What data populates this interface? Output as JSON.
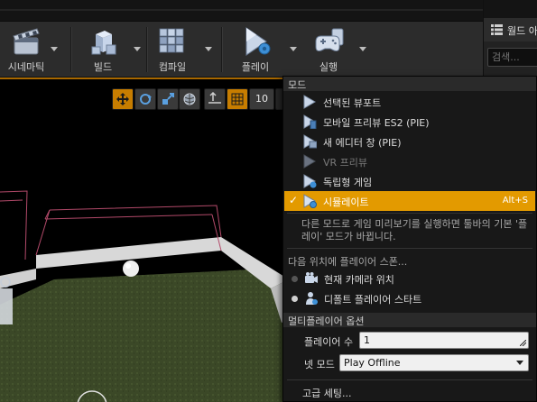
{
  "toolbar": {
    "buttons": [
      {
        "label": "시네마틱",
        "icon": "clapperboard-icon"
      },
      {
        "label": "빌드",
        "icon": "build-blocks-icon"
      },
      {
        "label": "컴파일",
        "icon": "compile-cubes-icon"
      },
      {
        "label": "플레이",
        "icon": "play-gear-icon"
      },
      {
        "label": "실행",
        "icon": "launch-gamepad-icon"
      }
    ]
  },
  "outliner": {
    "title": "월드 아",
    "search_placeholder": "검색..."
  },
  "viewport": {
    "grid_snap_value": "10"
  },
  "menu": {
    "mode_header": "모드",
    "mode_items": [
      {
        "label": "선택된 뷰포트",
        "enabled": true
      },
      {
        "label": "모바일 프리뷰 ES2 (PIE)",
        "enabled": true
      },
      {
        "label": "새 에디터 창 (PIE)",
        "enabled": true
      },
      {
        "label": "VR 프리뷰",
        "enabled": false
      },
      {
        "label": "독립형 게임",
        "enabled": true
      },
      {
        "label": "시뮬레이트",
        "enabled": true,
        "selected": true,
        "shortcut": "Alt+S"
      }
    ],
    "description": "다른 모드로 게임 미리보기를 실행하면 툴바의 기본 '플레이' 모드가 바뀝니다.",
    "spawn_header": "다음 위치에 플레이어 스폰...",
    "spawn_options": [
      {
        "label": "현재 카메라 위치",
        "selected": false
      },
      {
        "label": "디폴트 플레이어 스타트",
        "selected": true
      }
    ],
    "multiplayer_header": "멀티플레이어 옵션",
    "player_count_label": "플레이어 수",
    "player_count_value": "1",
    "net_mode_label": "넷 모드",
    "net_mode_value": "Play Offline",
    "advanced_settings": "고급 세팅..."
  },
  "colors": {
    "accent_orange": "#e39a00",
    "menu_bg": "#181818",
    "toolbar_bg": "#2c2c2c"
  }
}
